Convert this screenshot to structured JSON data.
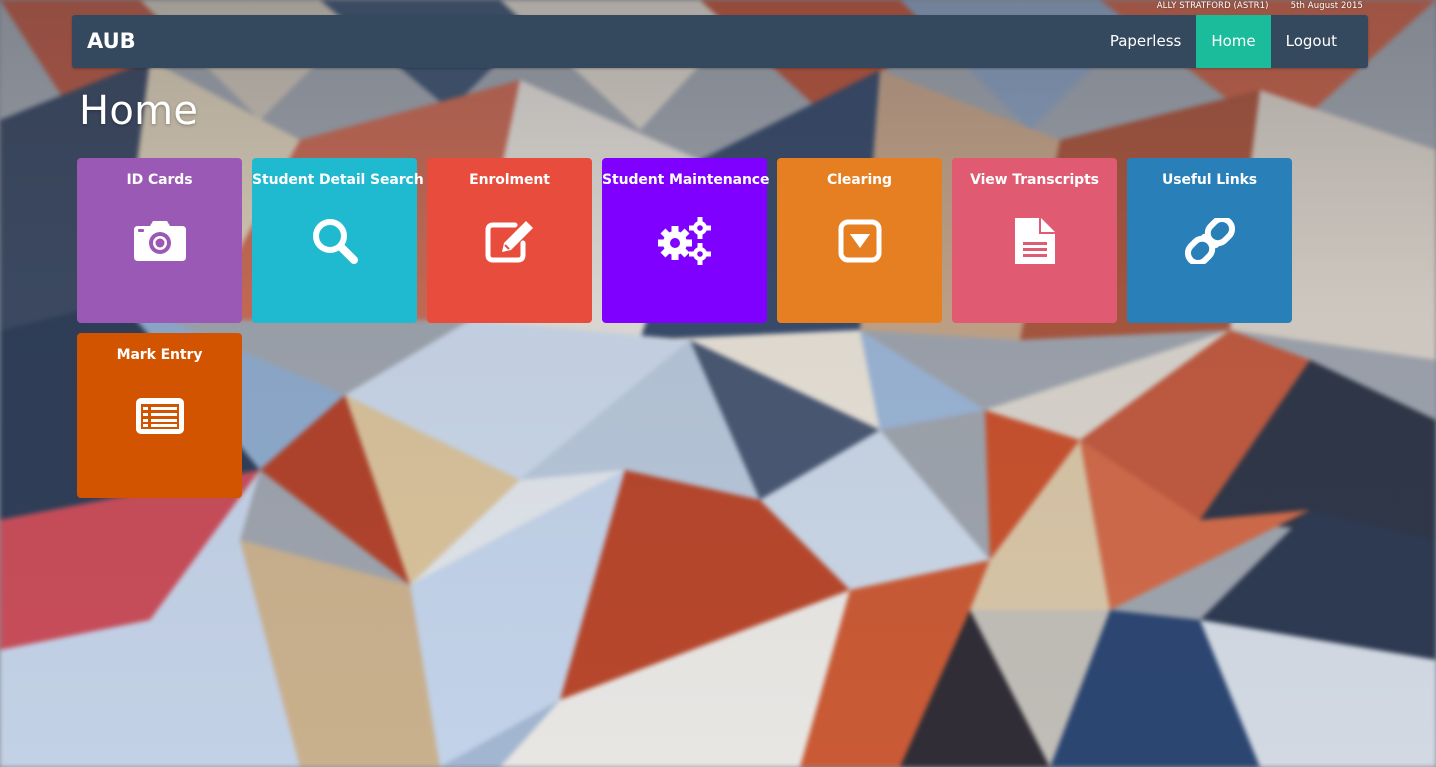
{
  "user": {
    "name": "ALLY STRATFORD (ASTR1)",
    "date": "5th August 2015"
  },
  "navbar": {
    "brand": "AUB",
    "links": [
      {
        "label": "Paperless",
        "active": false
      },
      {
        "label": "Home",
        "active": true
      },
      {
        "label": "Logout",
        "active": false
      }
    ],
    "colors": {
      "bar": "#34495e",
      "active": "#1abc9c"
    }
  },
  "page": {
    "title": "Home"
  },
  "tiles": [
    {
      "label": "ID Cards",
      "icon": "camera-icon",
      "color": "#9b59b6"
    },
    {
      "label": "Student Detail Search",
      "icon": "search-icon",
      "color": "#1fbad0"
    },
    {
      "label": "Enrolment",
      "icon": "edit-icon",
      "color": "#e74c3c"
    },
    {
      "label": "Student Maintenance",
      "icon": "gears-icon",
      "color": "#8000ff"
    },
    {
      "label": "Clearing",
      "icon": "caret-square-down-icon",
      "color": "#e67e22"
    },
    {
      "label": "View Transcripts",
      "icon": "document-icon",
      "color": "#e05a72"
    },
    {
      "label": "Useful Links",
      "icon": "link-icon",
      "color": "#2980b9"
    },
    {
      "label": "Mark Entry",
      "icon": "list-alt-icon",
      "color": "#d35400"
    }
  ]
}
